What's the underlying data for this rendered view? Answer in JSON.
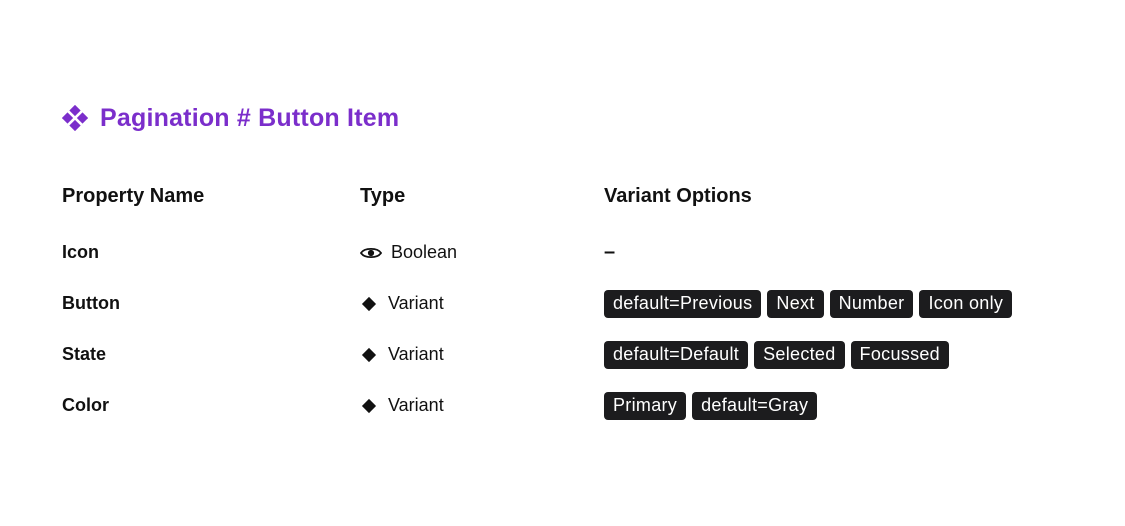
{
  "header": {
    "title": "Pagination # Button Item",
    "icon": "component-icon",
    "accent_color": "#7b2ecb"
  },
  "table": {
    "columns": [
      "Property Name",
      "Type",
      "Variant Options"
    ],
    "rows": [
      {
        "name": "Icon",
        "type": "Boolean",
        "type_icon": "eye-icon",
        "options_text": "–"
      },
      {
        "name": "Button",
        "type": "Variant",
        "type_icon": "diamond-icon",
        "options": [
          "default=Previous",
          "Next",
          "Number",
          "Icon only"
        ]
      },
      {
        "name": "State",
        "type": "Variant",
        "type_icon": "diamond-icon",
        "options": [
          "default=Default",
          "Selected",
          "Focussed"
        ]
      },
      {
        "name": "Color",
        "type": "Variant",
        "type_icon": "diamond-icon",
        "options": [
          "Primary",
          "default=Gray"
        ]
      }
    ]
  }
}
